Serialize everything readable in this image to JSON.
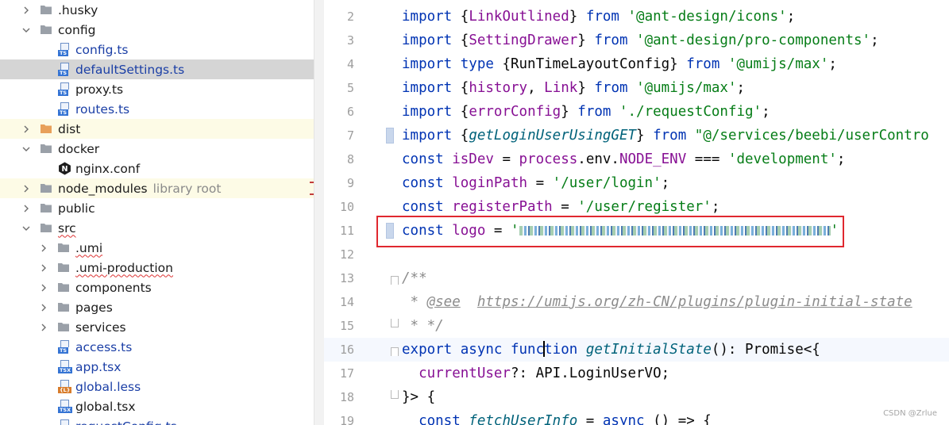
{
  "tree": [
    {
      "label": "husky",
      "type": "folder",
      "depth": 0,
      "expanded": false
    },
    {
      "label": "config",
      "type": "folder",
      "depth": 0,
      "expanded": true
    },
    {
      "label": "config.ts",
      "type": "ts",
      "depth": 1,
      "blue": true
    },
    {
      "label": "defaultSettings.ts",
      "type": "ts",
      "depth": 1,
      "blue": true,
      "selected": true
    },
    {
      "label": "proxy.ts",
      "type": "ts",
      "depth": 1
    },
    {
      "label": "routes.ts",
      "type": "ts",
      "depth": 1,
      "blue": true
    },
    {
      "label": "dist",
      "type": "folder-orange",
      "depth": 0,
      "expanded": false,
      "excluded": true
    },
    {
      "label": "docker",
      "type": "folder",
      "depth": 0,
      "expanded": true
    },
    {
      "label": "nginx.conf",
      "type": "nginx",
      "depth": 1
    },
    {
      "label": "node_modules",
      "suffix": "library root",
      "type": "folder",
      "depth": 0,
      "expanded": false,
      "excluded": true,
      "marker": true
    },
    {
      "label": "public",
      "type": "folder",
      "depth": 0,
      "expanded": false
    },
    {
      "label": "src",
      "type": "folder",
      "depth": 0,
      "expanded": true,
      "squiggle": true
    },
    {
      "label": ".umi",
      "type": "folder",
      "depth": 1,
      "expanded": false,
      "squiggle": true
    },
    {
      "label": ".umi-production",
      "type": "folder",
      "depth": 1,
      "expanded": false,
      "squiggle": true
    },
    {
      "label": "components",
      "type": "folder",
      "depth": 1,
      "expanded": false
    },
    {
      "label": "pages",
      "type": "folder",
      "depth": 1,
      "expanded": false
    },
    {
      "label": "services",
      "type": "folder",
      "depth": 1,
      "expanded": false
    },
    {
      "label": "access.ts",
      "type": "ts",
      "depth": 1,
      "blue": true
    },
    {
      "label": "app.tsx",
      "type": "tsx",
      "depth": 1,
      "blue": true
    },
    {
      "label": "global.less",
      "type": "less",
      "depth": 1,
      "blue": true
    },
    {
      "label": "global.tsx",
      "type": "tsx",
      "depth": 1
    },
    {
      "label": "requestConfig.ts",
      "type": "ts",
      "depth": 1,
      "blue": true
    }
  ],
  "icon_tags": {
    "ts": "TS",
    "tsx": "TSX",
    "less": "{L}",
    "nginx": "N"
  },
  "editor": {
    "lines": [
      {
        "n": "2",
        "tokens": [
          [
            "kw",
            "import "
          ],
          [
            "",
            "{"
          ],
          [
            "var",
            "LinkOutlined"
          ],
          [
            "",
            "} "
          ],
          [
            "kw",
            "from "
          ],
          [
            "str",
            "'@ant-design/icons'"
          ],
          [
            "",
            ";"
          ]
        ]
      },
      {
        "n": "3",
        "tokens": [
          [
            "kw",
            "import "
          ],
          [
            "",
            "{"
          ],
          [
            "var",
            "SettingDrawer"
          ],
          [
            "",
            "} "
          ],
          [
            "kw",
            "from "
          ],
          [
            "str",
            "'@ant-design/pro-components'"
          ],
          [
            "",
            ";"
          ]
        ]
      },
      {
        "n": "4",
        "tokens": [
          [
            "kw",
            "import type "
          ],
          [
            "",
            "{RunTimeLayoutConfig} "
          ],
          [
            "kw",
            "from "
          ],
          [
            "str",
            "'@umijs/max'"
          ],
          [
            "",
            ";"
          ]
        ]
      },
      {
        "n": "5",
        "tokens": [
          [
            "kw",
            "import "
          ],
          [
            "",
            "{"
          ],
          [
            "var",
            "history"
          ],
          [
            "",
            ", "
          ],
          [
            "var",
            "Link"
          ],
          [
            "",
            "} "
          ],
          [
            "kw",
            "from "
          ],
          [
            "str",
            "'@umijs/max'"
          ],
          [
            "",
            ";"
          ]
        ]
      },
      {
        "n": "6",
        "tokens": [
          [
            "kw",
            "import "
          ],
          [
            "",
            "{"
          ],
          [
            "var",
            "errorConfig"
          ],
          [
            "",
            "} "
          ],
          [
            "kw",
            "from "
          ],
          [
            "str",
            "'./requestConfig'"
          ],
          [
            "",
            ";"
          ]
        ]
      },
      {
        "n": "7",
        "mark": true,
        "tokens": [
          [
            "kw",
            "import "
          ],
          [
            "",
            "{"
          ],
          [
            "fn",
            "getLoginUserUsingGET"
          ],
          [
            "",
            "} "
          ],
          [
            "kw",
            "from "
          ],
          [
            "str",
            "\"@/services/beebi/userContro"
          ]
        ]
      },
      {
        "n": "8",
        "tokens": [
          [
            "kw",
            "const "
          ],
          [
            "var",
            "isDev"
          ],
          [
            "",
            " = "
          ],
          [
            "var",
            "process"
          ],
          [
            "",
            ".env."
          ],
          [
            "var",
            "NODE_ENV"
          ],
          [
            "",
            " === "
          ],
          [
            "str",
            "'development'"
          ],
          [
            "",
            ";"
          ]
        ]
      },
      {
        "n": "9",
        "tokens": [
          [
            "kw",
            "const "
          ],
          [
            "var",
            "loginPath"
          ],
          [
            "",
            " = "
          ],
          [
            "str",
            "'/user/login'"
          ],
          [
            "",
            ";"
          ]
        ]
      },
      {
        "n": "10",
        "tokens": [
          [
            "kw",
            "const "
          ],
          [
            "var",
            "registerPath"
          ],
          [
            "",
            " = "
          ],
          [
            "str",
            "'/user/register'"
          ],
          [
            "",
            ";"
          ]
        ]
      },
      {
        "n": "11",
        "mark": true,
        "tokens": [
          [
            "kw",
            "const "
          ],
          [
            "var",
            "logo"
          ],
          [
            "",
            " = "
          ],
          [
            "str",
            "'"
          ],
          [
            "blur",
            "                                "
          ],
          [
            "str",
            "'"
          ]
        ]
      },
      {
        "n": "12",
        "tokens": []
      },
      {
        "n": "13",
        "fold": "open",
        "tokens": [
          [
            "cmt",
            "/**"
          ]
        ]
      },
      {
        "n": "14",
        "tokens": [
          [
            "cmt",
            " * "
          ],
          [
            "doctag",
            "@see"
          ],
          [
            "cmt",
            "  "
          ],
          [
            "link",
            "https://umijs.org/zh-CN/plugins/plugin-initial-state"
          ]
        ]
      },
      {
        "n": "15",
        "fold": "close",
        "tokens": [
          [
            "cmt",
            " * */"
          ]
        ]
      },
      {
        "n": "16",
        "fold": "open",
        "current": true,
        "tokens": [
          [
            "kw",
            "export async "
          ],
          [
            "kw",
            "func"
          ],
          [
            "caret",
            ""
          ],
          [
            "kw",
            "tion "
          ],
          [
            "fn",
            "getInitialState"
          ],
          [
            "",
            "(): Promise<{"
          ]
        ]
      },
      {
        "n": "17",
        "tokens": [
          [
            "",
            "  "
          ],
          [
            "var",
            "currentUser"
          ],
          [
            "",
            "?: API.LoginUserVO;"
          ]
        ]
      },
      {
        "n": "18",
        "fold": "close",
        "tokens": [
          [
            "",
            "}> {"
          ]
        ]
      },
      {
        "n": "19",
        "tokens": [
          [
            "",
            "  "
          ],
          [
            "kw",
            "const "
          ],
          [
            "fn",
            "fetchUserInfo"
          ],
          [
            "",
            " = "
          ],
          [
            "kw",
            "async "
          ],
          [
            "",
            "() => {"
          ]
        ]
      }
    ]
  },
  "watermark": "CSDN @Zrlue"
}
